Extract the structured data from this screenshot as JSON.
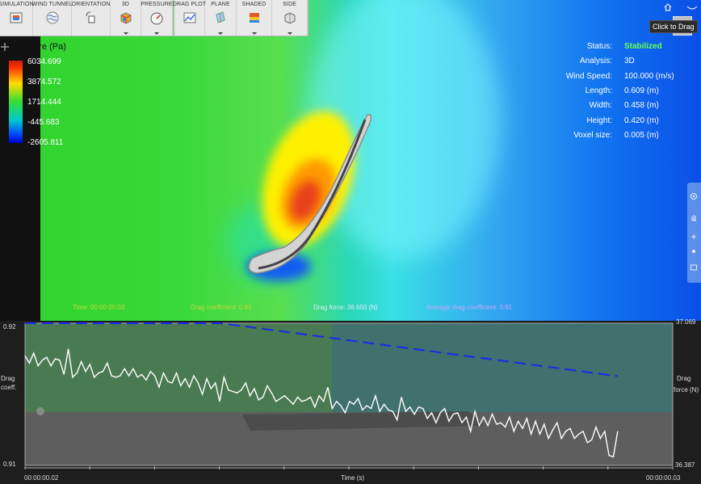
{
  "toolbar": {
    "items": [
      {
        "label": "SIMULATION",
        "icon": "simulation-icon"
      },
      {
        "label": "WIND TUNNEL",
        "icon": "wind-tunnel-icon"
      },
      {
        "label": "ORIENTATION",
        "icon": "orientation-icon"
      },
      {
        "label": "3D",
        "icon": "3d-icon"
      },
      {
        "label": "PRESSURE",
        "icon": "pressure-gauge-icon"
      },
      {
        "label": "DRAG PLOT",
        "icon": "drag-plot-icon"
      },
      {
        "label": "PLANE",
        "icon": "plane-icon"
      },
      {
        "label": "SHADED",
        "icon": "shaded-icon"
      },
      {
        "label": "SIDE",
        "icon": "side-view-icon"
      }
    ]
  },
  "legend": {
    "title": "Pressure (Pa)",
    "values": [
      "6034.699",
      "3874.572",
      "1714.444",
      "-445.683",
      "-2605.811"
    ]
  },
  "status": {
    "rows": [
      {
        "key": "Status:",
        "value": "Stabilized"
      },
      {
        "key": "Analysis:",
        "value": "3D"
      },
      {
        "key": "Wind Speed:",
        "value": "100.000 (m/s)"
      },
      {
        "key": "Length:",
        "value": "0.609 (m)"
      },
      {
        "key": "Width:",
        "value": "0.458 (m)"
      },
      {
        "key": "Height:",
        "value": "0.420 (m)"
      },
      {
        "key": "Voxel size:",
        "value": "0.005 (m)"
      }
    ]
  },
  "colors": {
    "status_good": "#66ff55",
    "plot_coeff_line": "#ffffff",
    "plot_force_line": "#1a2ee0"
  },
  "nav": {
    "tooltip": "Click to Drag"
  },
  "readout": {
    "time": "Time: 00:00:00.03",
    "drag_coefficient": "Drag coefficient: 0.91",
    "drag_force": "Drag force: 36.650 (N)",
    "avg_drag_coefficient": "Average drag coefficient: 0.91"
  },
  "plot": {
    "left_axis_title_line1": "Drag",
    "left_axis_title_line2": "coeff.",
    "right_axis_title_line1": "Drag",
    "right_axis_title_line2": "force (N)",
    "left_top": "0.92",
    "left_bottom": "0.91",
    "right_top": "37.069",
    "right_bottom": "36.387",
    "x_start": "00:00:00.02",
    "x_end": "00:00:00.03",
    "x_title": "Time (s)"
  },
  "chart_data": {
    "type": "line",
    "xlabel": "Time (s)",
    "x_range": [
      "00:00:00.02",
      "00:00:00.03"
    ],
    "left_ylabel": "Drag coeff.",
    "left_ylim": [
      0.91,
      0.92
    ],
    "right_ylabel": "Drag force (N)",
    "right_ylim": [
      36.387,
      37.069
    ],
    "series": [
      {
        "axis": "left",
        "values": [
          0.9177,
          0.9172,
          0.9179,
          0.917,
          0.9174,
          0.9176,
          0.917,
          0.9175,
          0.9174,
          0.9164,
          0.9182,
          0.9162,
          0.9165,
          0.9173,
          0.9166,
          0.9171,
          0.9162,
          0.9165,
          0.9166,
          0.9172,
          0.9163,
          0.9162,
          0.9163,
          0.9168,
          0.9163,
          0.9168,
          0.9162,
          0.9164,
          0.916,
          0.9166,
          0.9163,
          0.9155,
          0.9165,
          0.9159,
          0.9158,
          0.9165,
          0.9156,
          0.9161,
          0.9155,
          0.9163,
          0.9158,
          0.915,
          0.9161,
          0.9154,
          0.9158,
          0.9145,
          0.9162,
          0.9153,
          0.9152,
          0.9151,
          0.9153,
          0.9158,
          0.9149,
          0.9154,
          0.9146,
          0.9148,
          0.9156,
          0.9151,
          0.9145,
          0.9147,
          0.9149,
          0.9146,
          0.9143,
          0.9148,
          0.9145,
          0.9146,
          0.9148,
          0.9141,
          0.9149,
          0.9145,
          0.9155,
          0.914,
          0.9145,
          0.9142,
          0.9137,
          0.9145,
          0.9143,
          0.9147,
          0.9139,
          0.9142,
          0.914,
          0.9149,
          0.9138,
          0.9143,
          0.9139,
          0.9138,
          0.9132,
          0.9148,
          0.9138,
          0.9141,
          0.9136,
          0.9141,
          0.914,
          0.9133,
          0.9137,
          0.913,
          0.9137,
          0.914,
          0.9131,
          0.9136,
          0.9137,
          0.913,
          0.9134,
          0.9124,
          0.9138,
          0.9128,
          0.9134,
          0.9128,
          0.9136,
          0.9129,
          0.913,
          0.9127,
          0.9134,
          0.9124,
          0.9131,
          0.9126,
          0.9133,
          0.9122,
          0.9131,
          0.9122,
          0.9129,
          0.9119,
          0.9125,
          0.913,
          0.9119,
          0.9124,
          0.9126,
          0.9119,
          0.9122,
          0.9124,
          0.9116,
          0.9118,
          0.9127,
          0.9119,
          0.9124,
          0.9107,
          0.9106,
          0.9124
        ]
      },
      {
        "axis": "right",
        "x_fraction": [
          0,
          0.33,
          1
        ],
        "values": [
          37.069,
          37.069,
          36.815
        ]
      }
    ]
  }
}
